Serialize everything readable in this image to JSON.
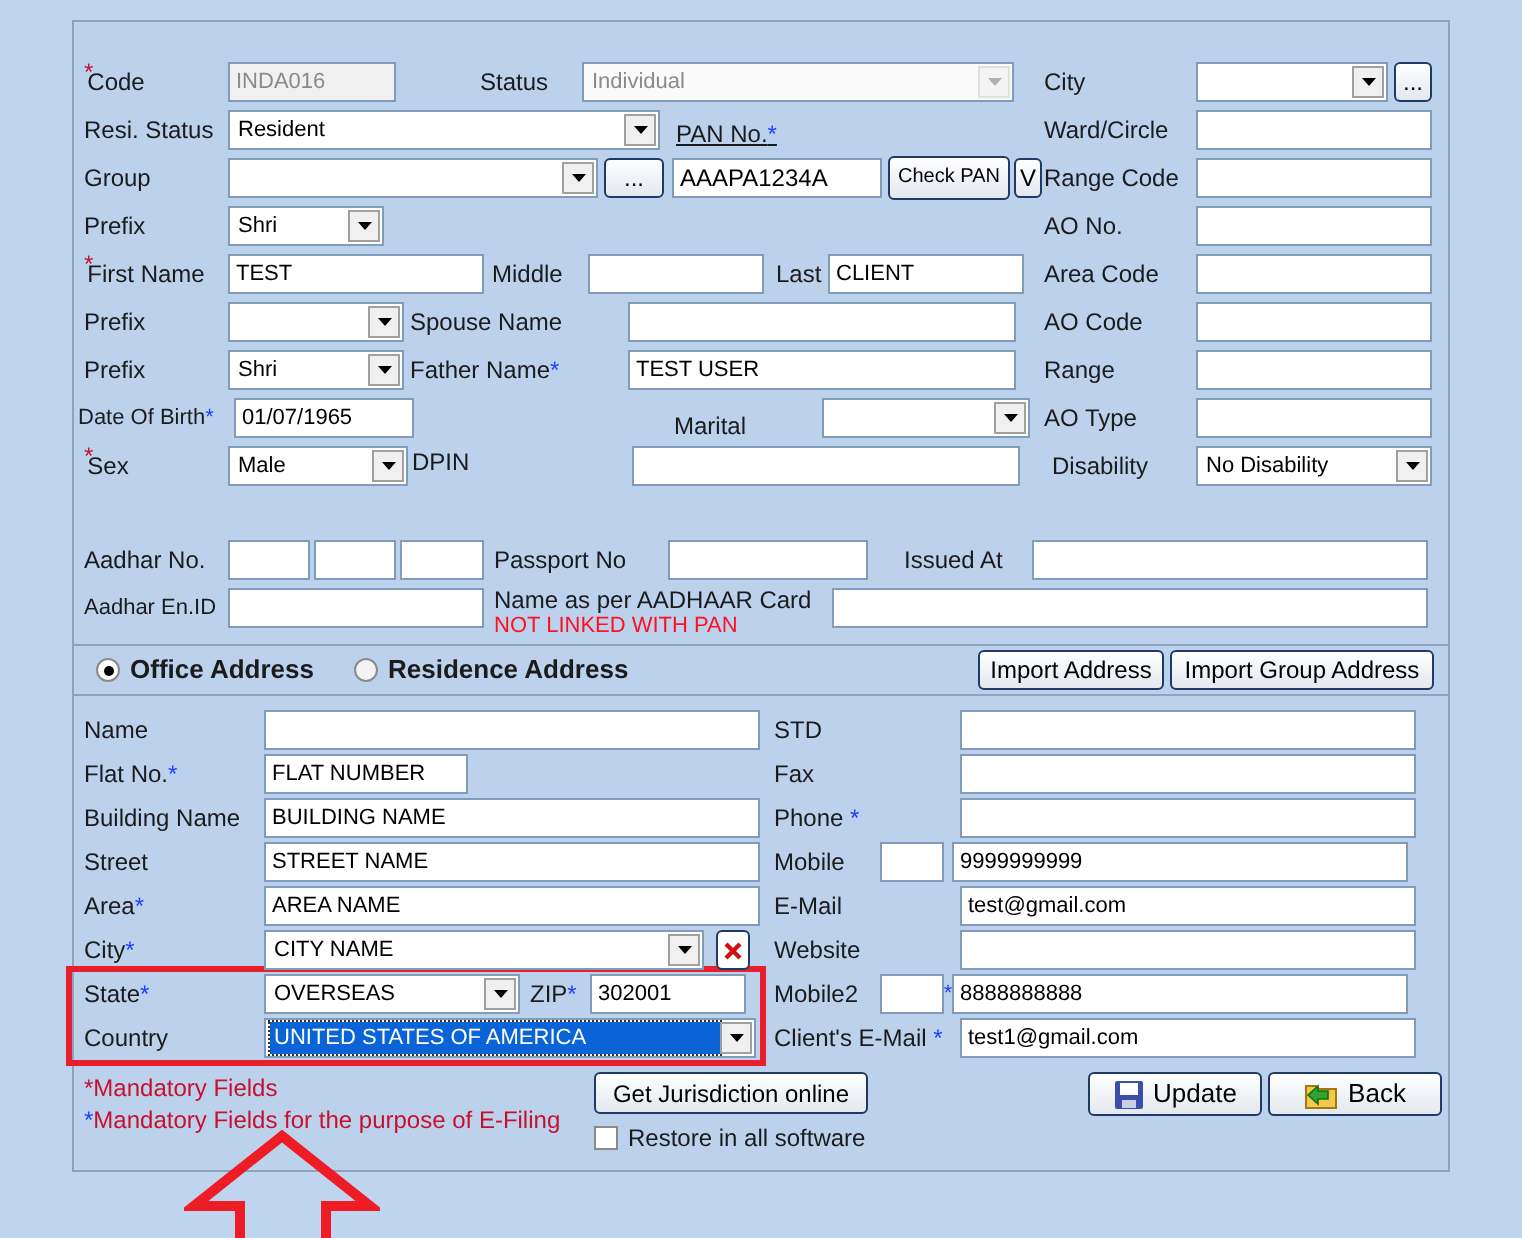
{
  "personal": {
    "code": {
      "label": "Code",
      "marker": {
        "text": "*",
        "kind": "mandatory"
      },
      "value": "INDA016",
      "disabled": true
    },
    "status": {
      "label": "Status",
      "value": "Individual",
      "disabled": true
    },
    "resi_status": {
      "label": "Resi. Status",
      "value": "Resident"
    },
    "pan": {
      "label": "PAN No.",
      "marker": {
        "text": "*",
        "kind": "efiling"
      },
      "link": true,
      "value": "AAAPA1234A",
      "check_button": "Check PAN",
      "verify_button": "V"
    },
    "group": {
      "label": "Group",
      "browse_button": "..."
    },
    "prefix": {
      "label": "Prefix",
      "value": "Shri"
    },
    "first_name": {
      "label": "First Name",
      "marker": {
        "text": "*",
        "kind": "mandatory"
      },
      "value": "TEST"
    },
    "middle_name": {
      "label": "Middle"
    },
    "last_name": {
      "label": "Last",
      "value": "CLIENT"
    },
    "spouse_prefix": {
      "label": "Prefix"
    },
    "spouse_name": {
      "label": "Spouse Name"
    },
    "father_prefix": {
      "label": "Prefix",
      "value": "Shri"
    },
    "father_name": {
      "label": "Father Name",
      "marker": {
        "text": "*",
        "kind": "efiling"
      },
      "value": "TEST USER"
    },
    "date_of_birth": {
      "label": "Date Of Birth",
      "marker": {
        "text": "*",
        "kind": "efiling"
      },
      "value": "01/07/1965"
    },
    "marital": {
      "label": "Marital"
    },
    "sex": {
      "label": "Sex",
      "marker": {
        "text": "*",
        "kind": "mandatory"
      },
      "value": "Male"
    },
    "dpin": {
      "label": "DPIN"
    },
    "aadhar_no": {
      "label": "Aadhar No."
    },
    "passport_no": {
      "label": "Passport No"
    },
    "issued_at": {
      "label": "Issued At"
    },
    "aadhar_enrolment_id": {
      "label": "Aadhar En.ID"
    },
    "name_as_per_aadhaar": {
      "label": "Name as per AADHAAR Card",
      "warning": "NOT LINKED WITH PAN"
    }
  },
  "jurisdiction": [
    {
      "label": "City",
      "kind": "select",
      "browse_button": "..."
    },
    {
      "label": "Ward/Circle",
      "kind": "text"
    },
    {
      "label": "Range Code",
      "kind": "text"
    },
    {
      "label": "AO No.",
      "kind": "text"
    },
    {
      "label": "Area Code",
      "kind": "text"
    },
    {
      "label": "AO Code",
      "kind": "text"
    },
    {
      "label": "Range",
      "kind": "text"
    },
    {
      "label": "AO Type",
      "kind": "text"
    },
    {
      "label": "Disability",
      "kind": "select",
      "value": "No Disability"
    }
  ],
  "address_tabs": [
    {
      "label": "Office Address",
      "selected": true
    },
    {
      "label": "Residence Address",
      "selected": false
    }
  ],
  "import_buttons": [
    "Import Address",
    "Import Group Address"
  ],
  "address_left": [
    {
      "label": "Name",
      "kind": "text"
    },
    {
      "label": "Flat No.",
      "marker": {
        "text": "*",
        "kind": "efiling"
      },
      "kind": "text",
      "value": "FLAT NUMBER"
    },
    {
      "label": "Building Name",
      "kind": "text",
      "value": "BUILDING NAME"
    },
    {
      "label": "Street",
      "kind": "text",
      "value": "STREET NAME"
    },
    {
      "label": "Area",
      "marker": {
        "text": "*",
        "kind": "efiling"
      },
      "kind": "text",
      "value": "AREA NAME"
    },
    {
      "label": "City",
      "marker": {
        "text": "*",
        "kind": "efiling"
      },
      "kind": "select",
      "value": "CITY NAME",
      "clearable": true
    },
    {
      "label": "State",
      "marker": {
        "text": "*",
        "kind": "efiling"
      },
      "kind": "select",
      "value": "OVERSEAS",
      "zip": {
        "label": "ZIP",
        "marker": {
          "text": "*",
          "kind": "efiling"
        },
        "value": "302001"
      }
    },
    {
      "label": "Country",
      "kind": "select",
      "value": "UNITED STATES OF AMERICA",
      "focused": true
    }
  ],
  "address_right": [
    {
      "label": "STD",
      "kind": "text"
    },
    {
      "label": "Fax",
      "kind": "text"
    },
    {
      "label": "Phone ",
      "marker": {
        "text": "*",
        "kind": "efiling"
      },
      "kind": "text"
    },
    {
      "label": "Mobile",
      "kind": "phone",
      "value": "9999999999"
    },
    {
      "label": "E-Mail",
      "kind": "text",
      "value": "test@gmail.com"
    },
    {
      "label": "Website",
      "kind": "text"
    },
    {
      "label": "Mobile2",
      "kind": "phone",
      "marker": {
        "text": "*",
        "kind": "efiling"
      },
      "value": "8888888888"
    },
    {
      "label": "Client's E-Mail ",
      "marker": {
        "text": "*",
        "kind": "efiling"
      },
      "kind": "text",
      "value": "test1@gmail.com"
    }
  ],
  "legend": [
    {
      "marker": {
        "text": "*",
        "kind": "mandatory"
      },
      "text": "Mandatory Fields"
    },
    {
      "marker": {
        "text": "*",
        "kind": "efiling"
      },
      "text": "Mandatory Fields for the purpose of E-Filing"
    }
  ],
  "jurisdiction_button": "Get Jurisdiction online",
  "restore": {
    "label": "Restore in all software",
    "checked": false
  },
  "actions": [
    {
      "label": "Update",
      "kind": "save"
    },
    {
      "label": "Back",
      "kind": "back"
    }
  ],
  "annotation": {
    "highlight_frame": true,
    "arrow": true
  }
}
